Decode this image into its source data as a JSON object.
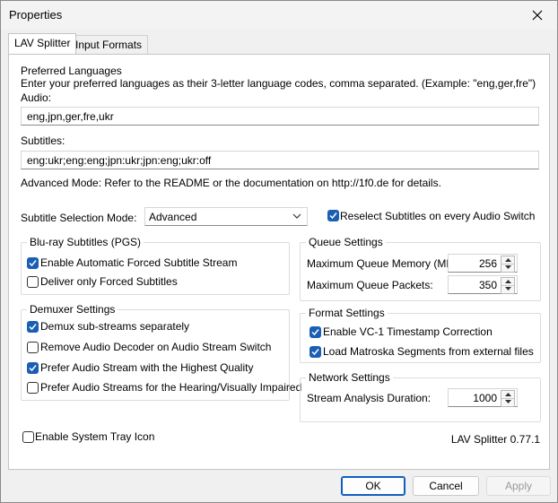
{
  "window": {
    "title": "Properties"
  },
  "tabs": [
    {
      "label": "LAV Splitter"
    },
    {
      "label": "Input Formats"
    }
  ],
  "languages": {
    "heading": "Preferred Languages",
    "description": "Enter your preferred languages as their 3-letter language codes, comma separated. (Example: \"eng,ger,fre\")",
    "audio_label": "Audio:",
    "audio_value": "eng,jpn,ger,fre,ukr",
    "subtitles_label": "Subtitles:",
    "subtitles_value": "eng:ukr;eng:eng;jpn:ukr;jpn:eng;ukr:off",
    "advanced_note": "Advanced Mode: Refer to the README or the documentation on http://1f0.de for details."
  },
  "subtitle_mode": {
    "label": "Subtitle Selection Mode:",
    "value": "Advanced",
    "reselect_label": "Reselect Subtitles on every Audio Switch",
    "reselect_checked": true
  },
  "bluray": {
    "title": "Blu-ray Subtitles (PGS)",
    "options": [
      {
        "label": "Enable Automatic Forced Subtitle Stream",
        "checked": true
      },
      {
        "label": "Deliver only Forced Subtitles",
        "checked": false
      }
    ]
  },
  "demuxer": {
    "title": "Demuxer Settings",
    "options": [
      {
        "label": "Demux sub-streams separately",
        "checked": true
      },
      {
        "label": "Remove Audio Decoder on Audio Stream Switch",
        "checked": false
      },
      {
        "label": "Prefer Audio Stream with the Highest Quality",
        "checked": true
      },
      {
        "label": "Prefer Audio Streams for the Hearing/Visually Impaired",
        "checked": false
      }
    ]
  },
  "queue": {
    "title": "Queue Settings",
    "memory_label": "Maximum Queue Memory (MB):",
    "memory_value": "256",
    "packets_label": "Maximum Queue Packets:",
    "packets_value": "350"
  },
  "format": {
    "title": "Format Settings",
    "options": [
      {
        "label": "Enable VC-1 Timestamp Correction",
        "checked": true
      },
      {
        "label": "Load Matroska Segments from external files",
        "checked": true
      }
    ]
  },
  "network": {
    "title": "Network Settings",
    "duration_label": "Stream Analysis Duration:",
    "duration_value": "1000"
  },
  "tray": {
    "label": "Enable System Tray Icon",
    "checked": false
  },
  "version": "LAV Splitter 0.77.1",
  "buttons": {
    "ok": "OK",
    "cancel": "Cancel",
    "apply": "Apply"
  },
  "icons": {
    "close": "close-icon",
    "check": "check-icon",
    "chevron": "chevron-down-icon",
    "spin_up": "spin-up-icon",
    "spin_down": "spin-down-icon"
  },
  "colors": {
    "checkbox_accent": "#1a5fb4",
    "default_button_border": "#0f5fbf"
  }
}
